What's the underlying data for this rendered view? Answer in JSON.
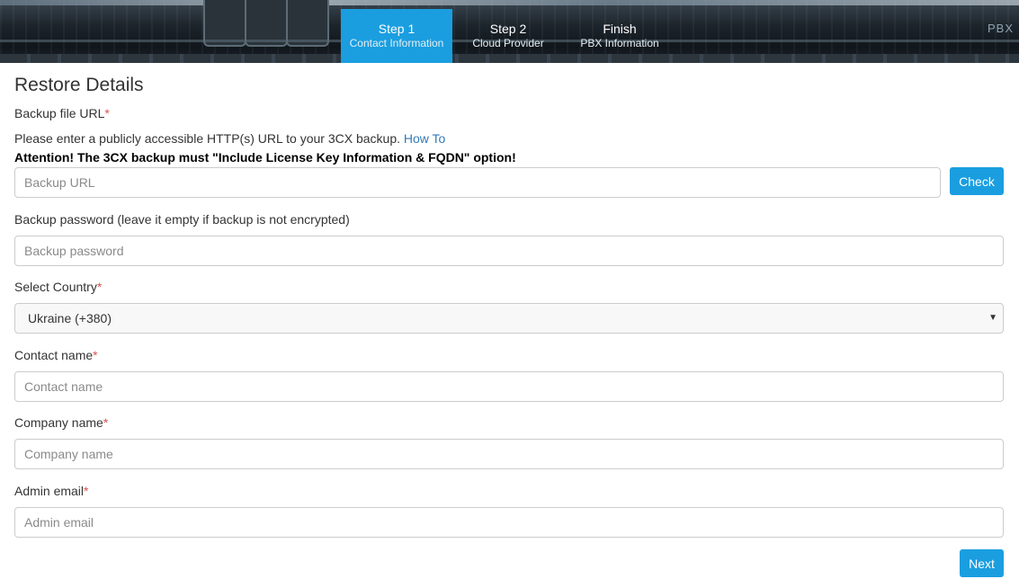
{
  "header": {
    "brand_text": "PBX",
    "steps": [
      {
        "title": "Step 1",
        "subtitle": "Contact Information",
        "active": true
      },
      {
        "title": "Step 2",
        "subtitle": "Cloud Provider",
        "active": false
      },
      {
        "title": "Finish",
        "subtitle": "PBX Information",
        "active": false
      }
    ]
  },
  "form": {
    "title": "Restore Details",
    "backup_url": {
      "label": "Backup file URL",
      "required_mark": "*",
      "help_text": "Please enter a publicly accessible HTTP(s) URL to your 3CX backup.",
      "help_link": "How To",
      "attention": "Attention! The 3CX backup must \"Include License Key Information & FQDN\" option!",
      "placeholder": "Backup URL",
      "value": "",
      "check_button": "Check"
    },
    "backup_password": {
      "label": "Backup password (leave it empty if backup is not encrypted)",
      "placeholder": "Backup password",
      "value": ""
    },
    "country": {
      "label": "Select Country",
      "required_mark": "*",
      "selected": "Ukraine (+380)"
    },
    "contact_name": {
      "label": "Contact name",
      "required_mark": "*",
      "placeholder": "Contact name",
      "value": ""
    },
    "company_name": {
      "label": "Company name",
      "required_mark": "*",
      "placeholder": "Company name",
      "value": ""
    },
    "admin_email": {
      "label": "Admin email",
      "required_mark": "*",
      "placeholder": "Admin email",
      "value": ""
    },
    "next_button": "Next"
  },
  "colors": {
    "accent": "#1a9ee0",
    "required": "#d9534f",
    "link": "#337ab7"
  }
}
